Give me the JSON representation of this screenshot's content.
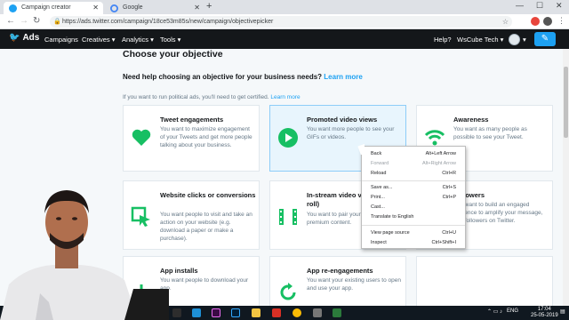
{
  "browser": {
    "tabs": [
      {
        "title": "Campaign creator",
        "active": true
      },
      {
        "title": "Google",
        "active": false
      }
    ],
    "url": "https://ads.twitter.com/campaign/18ce53m85s/new/campaign/objectivepicker"
  },
  "nav": {
    "brand": "Ads",
    "items": [
      "Campaigns",
      "Creatives",
      "Analytics",
      "Tools"
    ],
    "help": "Help?",
    "account": "WsCube Tech"
  },
  "page": {
    "heading": "Choose your objective",
    "help_question": "Need help choosing an objective for your business needs?",
    "help_link": "Learn more",
    "political_text": "If you want to run political ads, you'll need to get certified.",
    "political_link": "Learn more"
  },
  "cards": [
    {
      "title": "Tweet engagements",
      "desc": "You want to maximize engagement of your Tweets and get more people talking about your business.",
      "icon": "heart-icon",
      "color": "#17bf63"
    },
    {
      "title": "Promoted video views",
      "desc": "You want more people to see your GIFs or videos.",
      "icon": "play-icon",
      "color": "#17bf63"
    },
    {
      "title": "Awareness",
      "desc": "You want as many people as possible to see your Tweet.",
      "icon": "wifi-icon",
      "color": "#17bf63"
    },
    {
      "title": "Website clicks or conversions",
      "desc": "You want people to visit and take an action on your website (e.g. download a paper or make a purchase).",
      "icon": "cursor-click-icon",
      "color": "#17bf63"
    },
    {
      "title": "In-stream video views (pre-roll)",
      "desc": "You want to pair your videos with premium content.",
      "icon": "film-icon",
      "color": "#17bf63"
    },
    {
      "title": "Followers",
      "desc": "You want to build an engaged audience to amplify your message, and followers on Twitter.",
      "icon": "person-plus-icon",
      "color": "#17bf63"
    },
    {
      "title": "App installs",
      "desc": "You want people to download your app.",
      "icon": "download-icon",
      "color": "#17bf63"
    },
    {
      "title": "App re-engagements",
      "desc": "You want your existing users to open and use your app.",
      "icon": "refresh-icon",
      "color": "#17bf63"
    }
  ],
  "context_menu": {
    "items": [
      {
        "label": "Back",
        "shortcut": "Alt+Left Arrow",
        "disabled": false
      },
      {
        "label": "Forward",
        "shortcut": "Alt+Right Arrow",
        "disabled": true
      },
      {
        "label": "Reload",
        "shortcut": "Ctrl+R",
        "disabled": false
      },
      {
        "label": "Save as...",
        "shortcut": "Ctrl+S",
        "disabled": false
      },
      {
        "label": "Print...",
        "shortcut": "Ctrl+P",
        "disabled": false
      },
      {
        "label": "Cast...",
        "shortcut": "",
        "disabled": false
      },
      {
        "label": "Translate to English",
        "shortcut": "",
        "disabled": false
      },
      {
        "label": "View page source",
        "shortcut": "Ctrl+U",
        "disabled": false
      },
      {
        "label": "Inspect",
        "shortcut": "Ctrl+Shift+I",
        "disabled": false
      }
    ]
  },
  "taskbar": {
    "lang": "ENG",
    "time": "17:04",
    "date": "25-05-2019"
  },
  "colors": {
    "twitter_blue": "#1da1f2",
    "nav_bg": "#14171a",
    "icon_green": "#17bf63"
  }
}
